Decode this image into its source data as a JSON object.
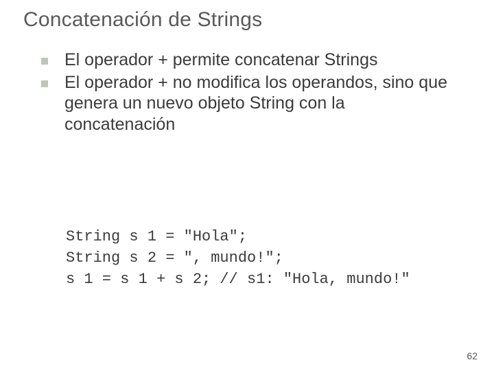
{
  "slide": {
    "title": "Concatenación de Strings",
    "bullets": [
      "El operador + permite concatenar Strings",
      "El operador + no modifica los operandos, sino que genera un nuevo objeto String con la concatenación"
    ],
    "code": {
      "line1": "String s 1 = \"Hola\";",
      "line2": "String s 2 = \", mundo!\";",
      "line3": "s 1 = s 1 + s 2; // s1: \"Hola, mundo!\""
    },
    "page_number": "62"
  }
}
